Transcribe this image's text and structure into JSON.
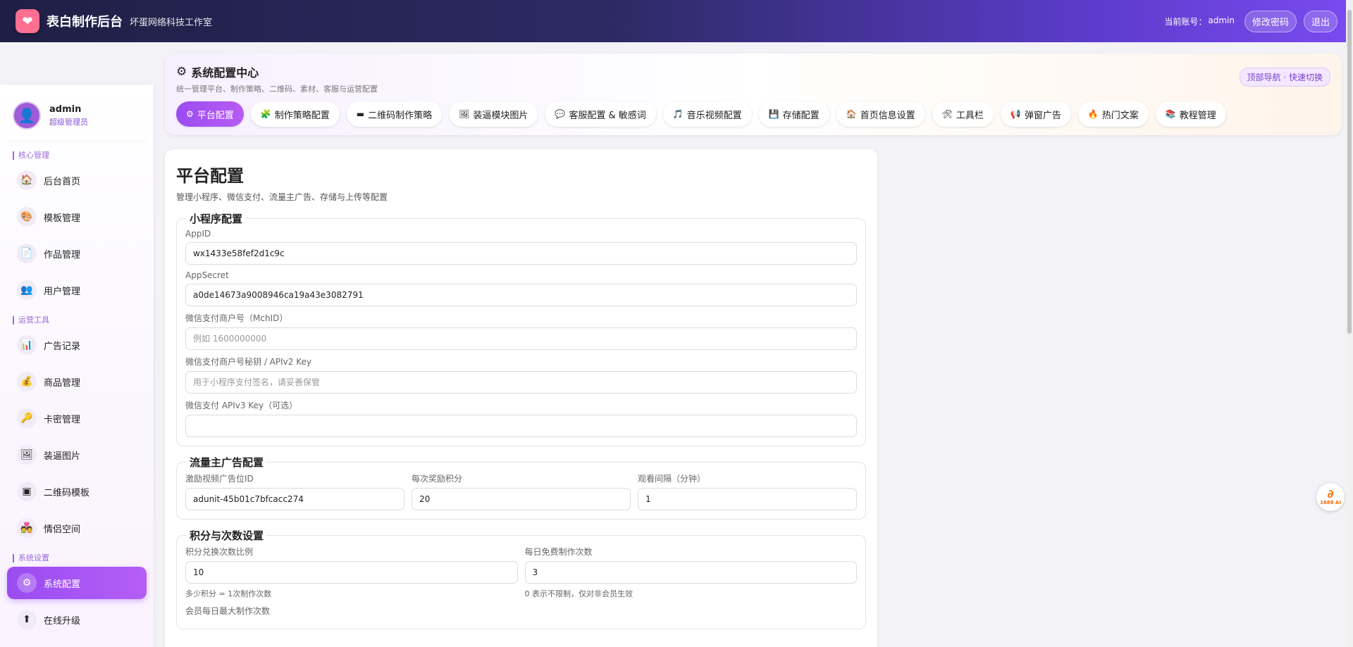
{
  "header": {
    "logo_icon": "heart-icon",
    "brand": "表白制作后台",
    "subtitle": "坏蛋网络科技工作室",
    "account_label": "当前账号：",
    "account_name": "admin",
    "change_password": "修改密码",
    "logout": "退出"
  },
  "sidebar": {
    "user": {
      "name": "admin",
      "role": "超级管理员"
    },
    "sections": [
      {
        "label": "核心管理",
        "items": [
          {
            "label": "后台首页",
            "icon": "🏠"
          },
          {
            "label": "模板管理",
            "icon": "🎨"
          },
          {
            "label": "作品管理",
            "icon": "📄"
          },
          {
            "label": "用户管理",
            "icon": "👥"
          }
        ]
      },
      {
        "label": "运营工具",
        "items": [
          {
            "label": "广告记录",
            "icon": "📊"
          },
          {
            "label": "商品管理",
            "icon": "💰"
          },
          {
            "label": "卡密管理",
            "icon": "🔑"
          },
          {
            "label": "装逼图片",
            "icon": "🖼"
          },
          {
            "label": "二维码模板",
            "icon": "▣"
          },
          {
            "label": "情侣空间",
            "icon": "💑"
          }
        ]
      },
      {
        "label": "系统设置",
        "items": [
          {
            "label": "系统配置",
            "icon": "⚙"
          },
          {
            "label": "在线升级",
            "icon": "⬆"
          }
        ]
      }
    ]
  },
  "config_center": {
    "title": "系统配置中心",
    "subtitle": "统一管理平台、制作策略、二维码、素材、客服与运营配置",
    "badge": "顶部导航 · 快速切换",
    "tabs": [
      {
        "label": "平台配置",
        "icon": "⚙"
      },
      {
        "label": "制作策略配置",
        "icon": "🧩"
      },
      {
        "label": "二维码制作策略",
        "icon": "▬"
      },
      {
        "label": "装逼模块图片",
        "icon": "🖼"
      },
      {
        "label": "客服配置 & 敏感词",
        "icon": "💬"
      },
      {
        "label": "音乐视频配置",
        "icon": "🎵"
      },
      {
        "label": "存储配置",
        "icon": "💾"
      },
      {
        "label": "首页信息设置",
        "icon": "🏠"
      },
      {
        "label": "工具栏",
        "icon": "🛠"
      },
      {
        "label": "弹窗广告",
        "icon": "📢"
      },
      {
        "label": "热门文案",
        "icon": "🔥"
      },
      {
        "label": "教程管理",
        "icon": "📚"
      }
    ]
  },
  "panel": {
    "title": "平台配置",
    "subtitle": "管理小程序、微信支付、流量主广告、存储与上传等配置",
    "miniapp": {
      "legend": "小程序配置",
      "appid_label": "AppID",
      "appid_value": "wx1433e58fef2d1c9c",
      "appsecret_label": "AppSecret",
      "appsecret_value": "a0de14673a9008946ca19a43e3082791",
      "mchid_label": "微信支付商户号（MchID）",
      "mchid_placeholder": "例如 1600000000",
      "apiv2_label": "微信支付商户号秘钥 / APIv2 Key",
      "apiv2_placeholder": "用于小程序支付签名，请妥善保管",
      "apiv3_label": "微信支付 APIv3 Key（可选）",
      "apiv3_value": ""
    },
    "ads": {
      "legend": "流量主广告配置",
      "unit_label": "激励视频广告位ID",
      "unit_value": "adunit-45b01c7bfcacc274",
      "points_label": "每次奖励积分",
      "points_value": "20",
      "interval_label": "观看间隔（分钟）",
      "interval_value": "1"
    },
    "points": {
      "legend": "积分与次数设置",
      "ratio_label": "积分兑换次数比例",
      "ratio_value": "10",
      "ratio_hint": "多少积分 = 1次制作次数",
      "free_label": "每日免费制作次数",
      "free_value": "3",
      "free_hint": "0 表示不限制，仅对非会员生效",
      "member_label": "会员每日最大制作次数"
    }
  },
  "widget": {
    "label": "1688 AI"
  }
}
